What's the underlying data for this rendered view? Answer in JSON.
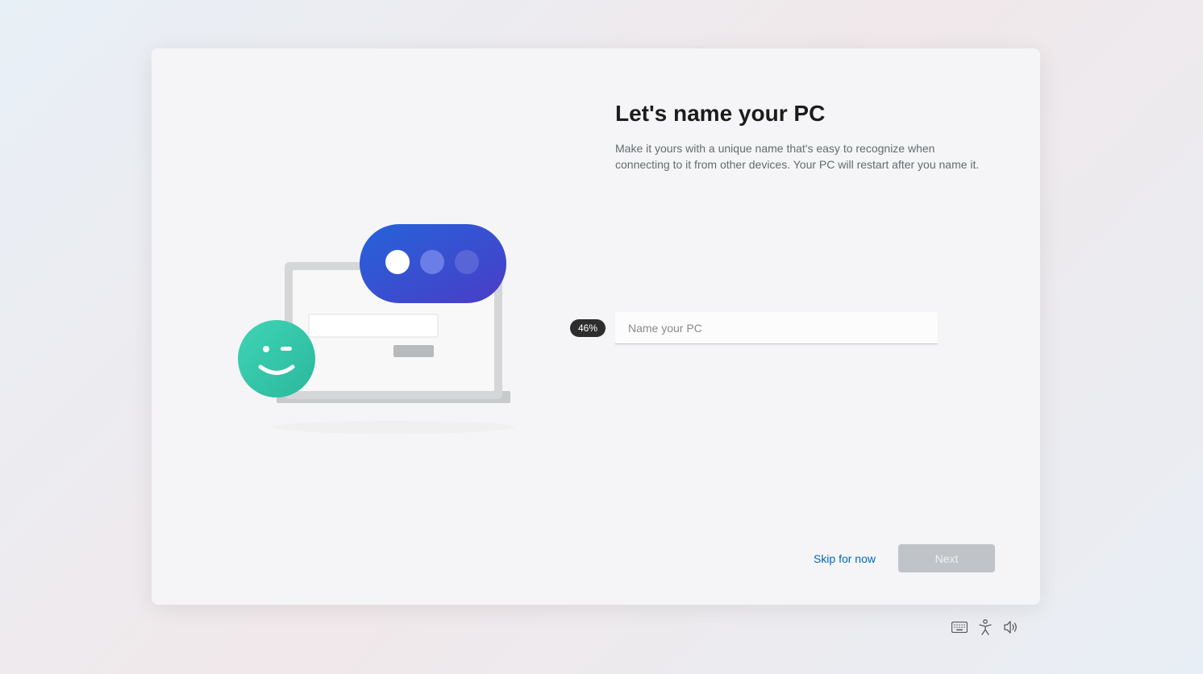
{
  "header": {
    "title": "Let's name your PC",
    "description": "Make it yours with a unique name that's easy to recognize when connecting to it from other devices. Your PC will restart after you name it."
  },
  "input": {
    "placeholder": "Name your PC",
    "value": ""
  },
  "progress": {
    "label": "46%"
  },
  "footer": {
    "skip_label": "Skip for now",
    "next_label": "Next"
  }
}
